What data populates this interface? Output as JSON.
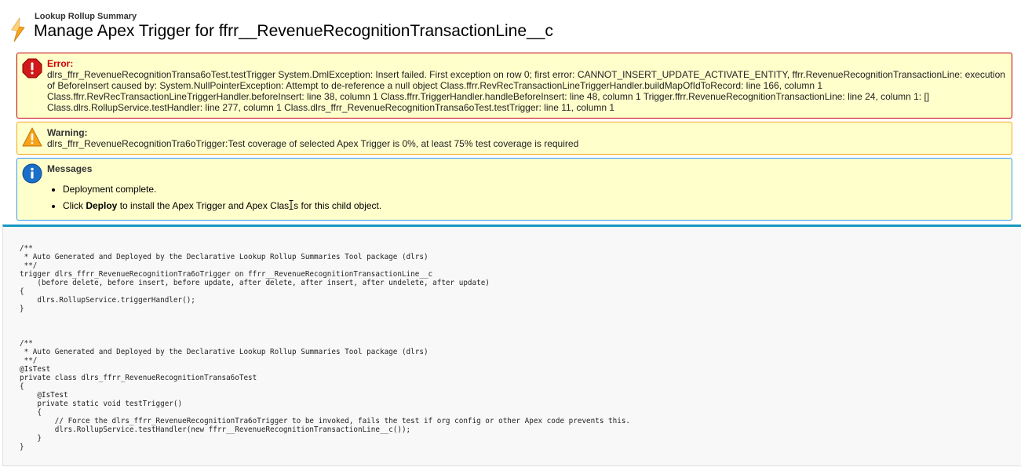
{
  "header": {
    "subtitle": "Lookup Rollup Summary",
    "title": "Manage Apex Trigger for ffrr__RevenueRecognitionTransactionLine__c",
    "icon": "lightning-icon"
  },
  "colors": {
    "error_border": "#c00000",
    "warning_border": "#f5a623",
    "info_border": "#3399ff",
    "message_bg": "#ffffcc",
    "code_accent": "#1797c0"
  },
  "error": {
    "title": "Error:",
    "icon": "error-icon",
    "text": "dlrs_ffrr_RevenueRecognitionTransa6oTest.testTrigger System.DmlException: Insert failed. First exception on row 0; first error: CANNOT_INSERT_UPDATE_ACTIVATE_ENTITY, ffrr.RevenueRecognitionTransactionLine: execution of BeforeInsert caused by: System.NullPointerException: Attempt to de-reference a null object Class.ffrr.RevRecTransactionLineTriggerHandler.buildMapOfIdToRecord: line 166, column 1 Class.ffrr.RevRecTransactionLineTriggerHandler.beforeInsert: line 38, column 1 Class.ffrr.TriggerHandler.handleBeforeInsert: line 48, column 1 Trigger.ffrr.RevenueRecognitionTransactionLine: line 24, column 1: [] Class.dlrs.RollupService.testHandler: line 277, column 1 Class.dlrs_ffrr_RevenueRecognitionTransa6oTest.testTrigger: line 11, column 1"
  },
  "warning": {
    "title": "Warning:",
    "icon": "warning-icon",
    "text": "dlrs_ffrr_RevenueRecognitionTra6oTrigger:Test coverage of selected Apex Trigger is 0%, at least 75% test coverage is required"
  },
  "messages": {
    "title": "Messages",
    "icon": "info-icon",
    "item1": "Deployment complete.",
    "item2_prefix": "Click ",
    "item2_bold": "Deploy",
    "item2_suffix_a": " to install the Apex Trigger and Apex Clas",
    "item2_suffix_b": "s for this child object."
  },
  "code": {
    "text": "/**\n * Auto Generated and Deployed by the Declarative Lookup Rollup Summaries Tool package (dlrs)\n **/\ntrigger dlrs_ffrr_RevenueRecognitionTra6oTrigger on ffrr__RevenueRecognitionTransactionLine__c\n    (before delete, before insert, before update, after delete, after insert, after undelete, after update)\n{\n    dlrs.RollupService.triggerHandler();\n}\n\n\n\n/**\n * Auto Generated and Deployed by the Declarative Lookup Rollup Summaries Tool package (dlrs)\n **/\n@IsTest\nprivate class dlrs_ffrr_RevenueRecognitionTransa6oTest\n{\n    @IsTest\n    private static void testTrigger()\n    {\n        // Force the dlrs_ffrr_RevenueRecognitionTra6oTrigger to be invoked, fails the test if org config or other Apex code prevents this.\n        dlrs.RollupService.testHandler(new ffrr__RevenueRecognitionTransactionLine__c());\n    }\n}"
  }
}
